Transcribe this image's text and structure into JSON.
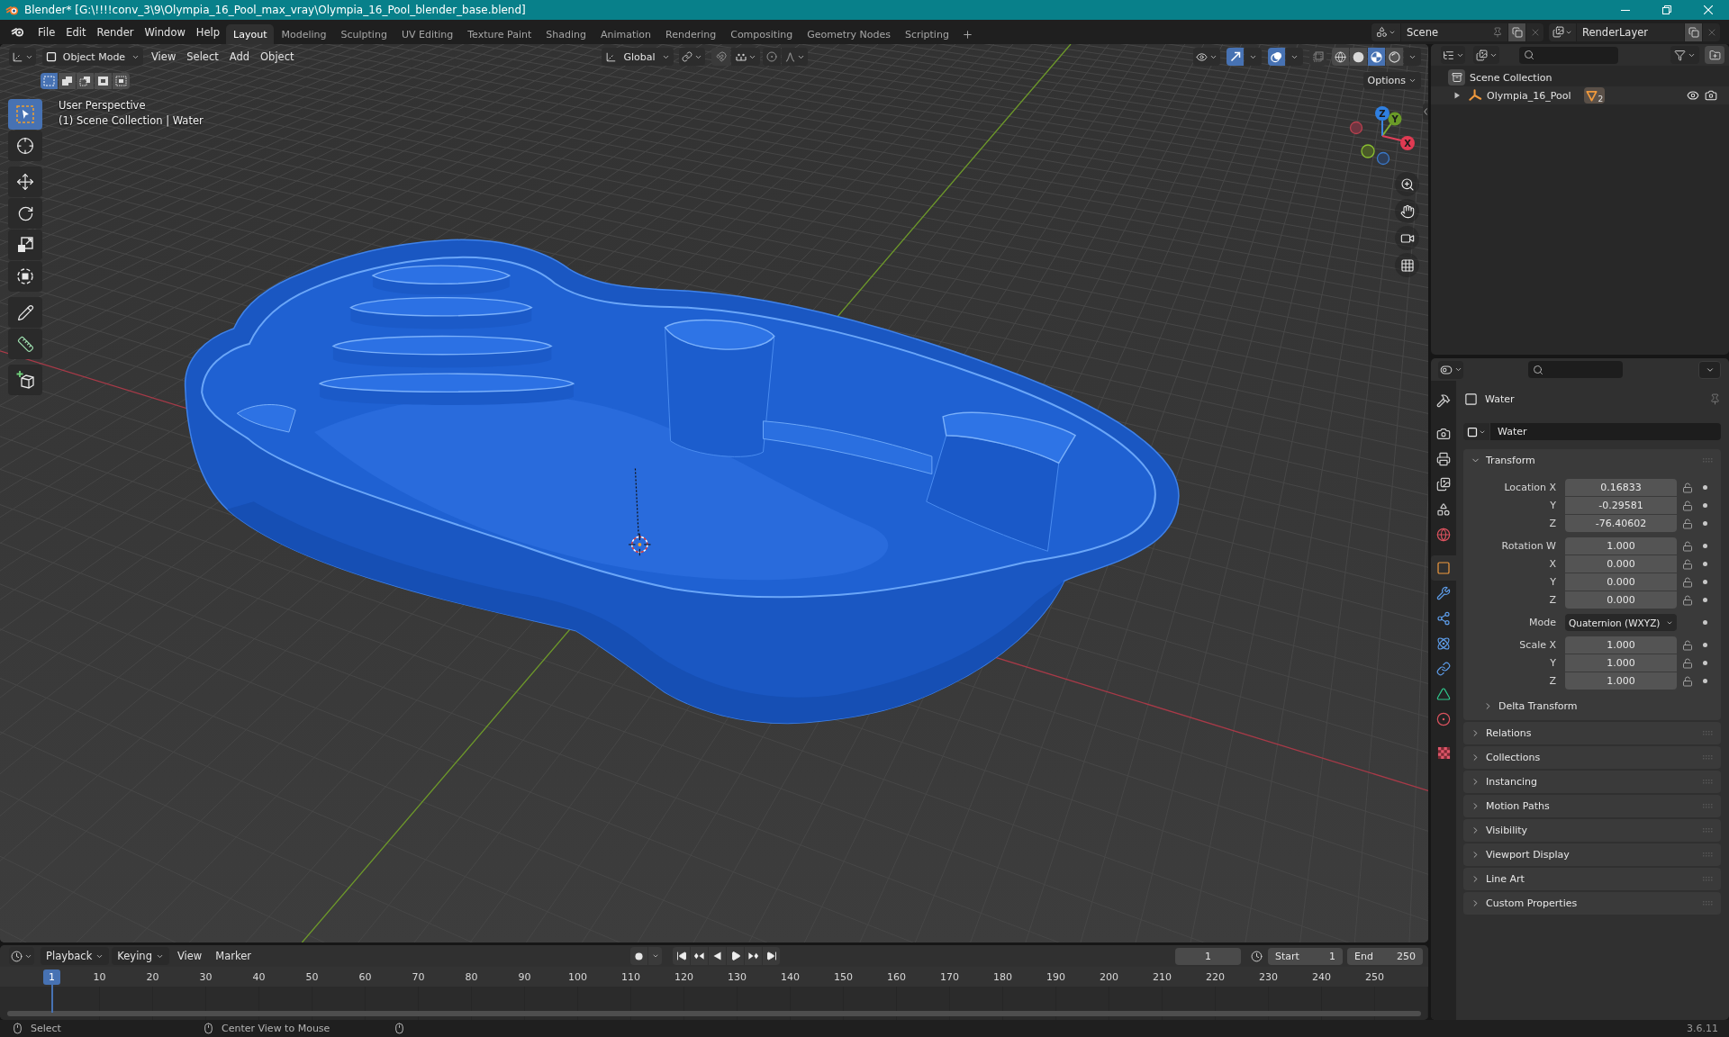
{
  "window": {
    "title": "Blender* [G:\\!!!!conv_3\\9\\Olympia_16_Pool_max_vray\\Olympia_16_Pool_blender_base.blend]"
  },
  "menu": [
    "File",
    "Edit",
    "Render",
    "Window",
    "Help"
  ],
  "workspaces": [
    {
      "label": "Layout",
      "selected": true
    },
    {
      "label": "Modeling",
      "selected": false
    },
    {
      "label": "Sculpting",
      "selected": false
    },
    {
      "label": "UV Editing",
      "selected": false
    },
    {
      "label": "Texture Paint",
      "selected": false
    },
    {
      "label": "Shading",
      "selected": false
    },
    {
      "label": "Animation",
      "selected": false
    },
    {
      "label": "Rendering",
      "selected": false
    },
    {
      "label": "Compositing",
      "selected": false
    },
    {
      "label": "Geometry Nodes",
      "selected": false
    },
    {
      "label": "Scripting",
      "selected": false
    }
  ],
  "scene": "Scene",
  "view_layer": "RenderLayer",
  "viewport": {
    "mode": "Object Mode",
    "menus": [
      "View",
      "Select",
      "Add",
      "Object"
    ],
    "orientation": "Global",
    "options": "Options",
    "selection_modes": [
      {
        "kind": "set",
        "selected": true
      },
      {
        "kind": "extend",
        "selected": false
      },
      {
        "kind": "subtract",
        "selected": false
      },
      {
        "kind": "invert",
        "selected": false
      },
      {
        "kind": "intersect",
        "selected": false
      }
    ],
    "show_gizmos": true,
    "show_overlays": true,
    "xray": false,
    "shading": [
      {
        "kind": "wireframe",
        "selected": false
      },
      {
        "kind": "solid",
        "selected": false
      },
      {
        "kind": "material",
        "selected": true
      },
      {
        "kind": "rendered",
        "selected": false
      }
    ],
    "tools": [
      [
        {
          "kind": "select",
          "selected": true
        },
        {
          "kind": "cursor",
          "selected": false
        }
      ],
      [
        {
          "kind": "move",
          "selected": false
        },
        {
          "kind": "rotate",
          "selected": false
        },
        {
          "kind": "scale",
          "selected": false
        },
        {
          "kind": "transform",
          "selected": false
        }
      ],
      [
        {
          "kind": "annotate",
          "selected": false
        },
        {
          "kind": "measure",
          "selected": false
        }
      ],
      [
        {
          "kind": "add_cube",
          "selected": false
        }
      ]
    ],
    "view_name": "User Perspective",
    "collection_info": "(1) Scene Collection | Water",
    "gizmo_labels": [
      "X",
      "Y",
      "Z"
    ]
  },
  "outliner": {
    "root": {
      "label": "Scene Collection",
      "children": [
        {
          "label": "Olympia_16_Pool",
          "expanded": false,
          "data_count": "2"
        }
      ]
    }
  },
  "properties": {
    "tabs": [
      [
        {
          "kind": "tool",
          "selected": false
        }
      ],
      [
        {
          "kind": "render",
          "selected": false
        },
        {
          "kind": "output",
          "selected": false
        },
        {
          "kind": "view_layer",
          "selected": false
        },
        {
          "kind": "scene",
          "selected": false
        },
        {
          "kind": "world",
          "selected": false
        }
      ],
      [
        {
          "kind": "object",
          "selected": true
        },
        {
          "kind": "modifiers",
          "selected": false
        },
        {
          "kind": "particles",
          "selected": false
        },
        {
          "kind": "physics",
          "selected": false
        },
        {
          "kind": "constraints",
          "selected": false
        },
        {
          "kind": "data",
          "selected": false
        },
        {
          "kind": "material",
          "selected": false
        }
      ],
      [
        {
          "kind": "texture",
          "selected": false
        }
      ]
    ],
    "object_name": "Water",
    "datablock": "Water",
    "transform": {
      "title": "Transform",
      "expanded": true,
      "groups": [
        {
          "rows": [
            {
              "kind": "number",
              "label": "Location X",
              "value": "0.16833",
              "locked": false
            },
            {
              "kind": "number",
              "label": "Y",
              "value": "-0.29581",
              "locked": false
            },
            {
              "kind": "number",
              "label": "Z",
              "value": "-76.40602",
              "locked": false
            }
          ]
        },
        {
          "rows": [
            {
              "kind": "number",
              "label": "Rotation W",
              "value": "1.000",
              "locked": false
            },
            {
              "kind": "number",
              "label": "X",
              "value": "0.000",
              "locked": false
            },
            {
              "kind": "number",
              "label": "Y",
              "value": "0.000",
              "locked": false
            },
            {
              "kind": "number",
              "label": "Z",
              "value": "0.000",
              "locked": false
            }
          ]
        },
        {
          "rows": [
            {
              "kind": "dropdown",
              "label": "Mode",
              "value": "Quaternion (WXYZ)"
            }
          ]
        },
        {
          "rows": [
            {
              "kind": "number",
              "label": "Scale X",
              "value": "1.000",
              "locked": false
            },
            {
              "kind": "number",
              "label": "Y",
              "value": "1.000",
              "locked": false
            },
            {
              "kind": "number",
              "label": "Z",
              "value": "1.000",
              "locked": false
            }
          ]
        }
      ],
      "subpanels": [
        {
          "title": "Delta Transform",
          "expanded": false
        }
      ]
    },
    "panels": [
      {
        "title": "Relations",
        "expanded": false
      },
      {
        "title": "Collections",
        "expanded": false
      },
      {
        "title": "Instancing",
        "expanded": false
      },
      {
        "title": "Motion Paths",
        "expanded": false
      },
      {
        "title": "Visibility",
        "expanded": false
      },
      {
        "title": "Viewport Display",
        "expanded": false
      },
      {
        "title": "Line Art",
        "expanded": false
      },
      {
        "title": "Custom Properties",
        "expanded": false
      }
    ]
  },
  "timeline": {
    "menus": [
      {
        "label": "Playback",
        "kind": "dropdown"
      },
      {
        "label": "Keying",
        "kind": "dropdown"
      },
      {
        "label": "View",
        "kind": "menu"
      },
      {
        "label": "Marker",
        "kind": "menu"
      }
    ],
    "current_frame": "1",
    "start_label": "Start",
    "start": "1",
    "end_label": "End",
    "end": "250",
    "playhead": "1",
    "ruler": [
      "10",
      "20",
      "30",
      "40",
      "50",
      "60",
      "70",
      "80",
      "90",
      "100",
      "110",
      "120",
      "130",
      "140",
      "150",
      "160",
      "170",
      "180",
      "190",
      "200",
      "210",
      "220",
      "230",
      "240",
      "250"
    ]
  },
  "status_bar": {
    "hints": [
      "Select",
      "Center View to Mouse"
    ],
    "version": "3.6.11"
  }
}
